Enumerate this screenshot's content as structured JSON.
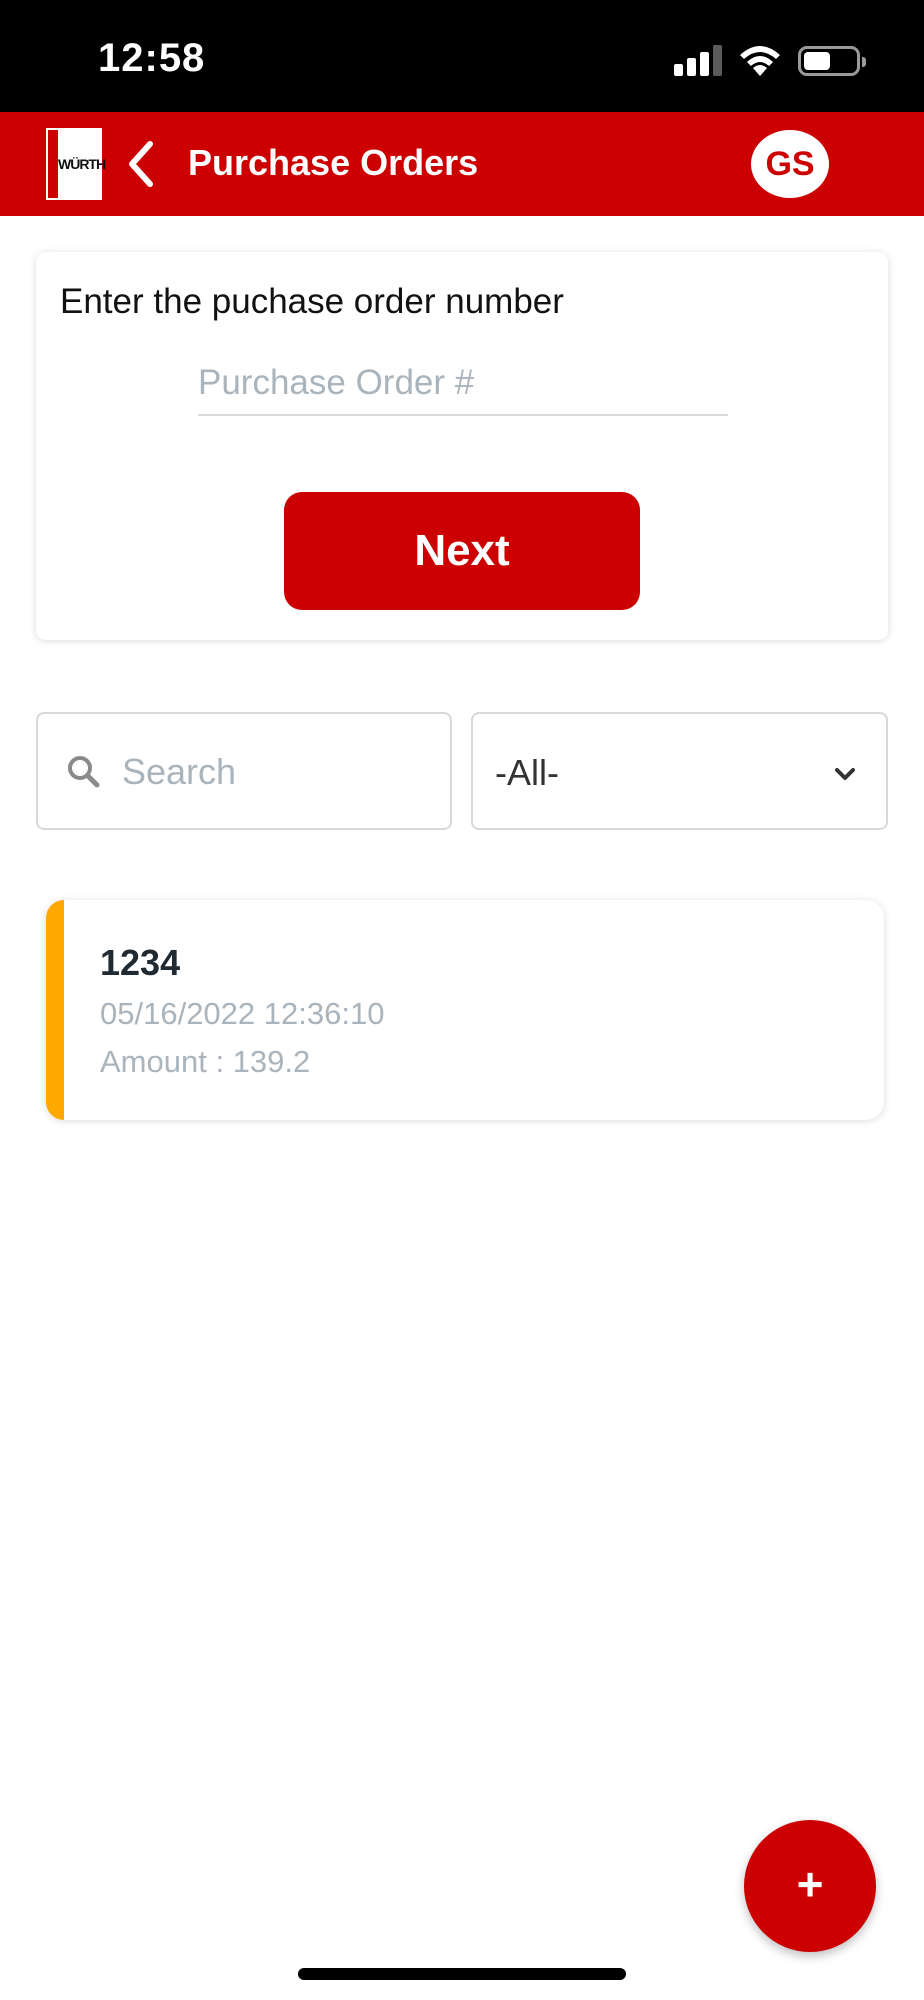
{
  "status_bar": {
    "time": "12:58",
    "icons": [
      "cellular-signal-icon",
      "wifi-icon",
      "battery-icon"
    ],
    "signal_bars_active": 3,
    "signal_bars_total": 4,
    "battery_level": 0.45
  },
  "header": {
    "logo_text": "WÜRTH",
    "back_icon": "chevron-left-icon",
    "title": "Purchase Orders",
    "avatar_initials": "GS",
    "color": "#cc0000"
  },
  "po_entry": {
    "prompt": "Enter the puchase order number",
    "input_value": "",
    "input_placeholder": "Purchase Order #",
    "next_label": "Next"
  },
  "filters": {
    "search_placeholder": "Search",
    "search_value": "",
    "search_icon": "search-icon",
    "status_selected": "-All-",
    "dropdown_icon": "chevron-down-icon"
  },
  "orders": [
    {
      "number": "1234",
      "datetime": "05/16/2022 12:36:10",
      "amount_text": "Amount : 139.2",
      "accent_color": "#ffa800"
    }
  ],
  "fab": {
    "label": "+",
    "icon": "plus-icon"
  },
  "colors": {
    "brand_red": "#cc0000",
    "accent_orange": "#ffa800",
    "muted_text": "#a9b4bd"
  }
}
